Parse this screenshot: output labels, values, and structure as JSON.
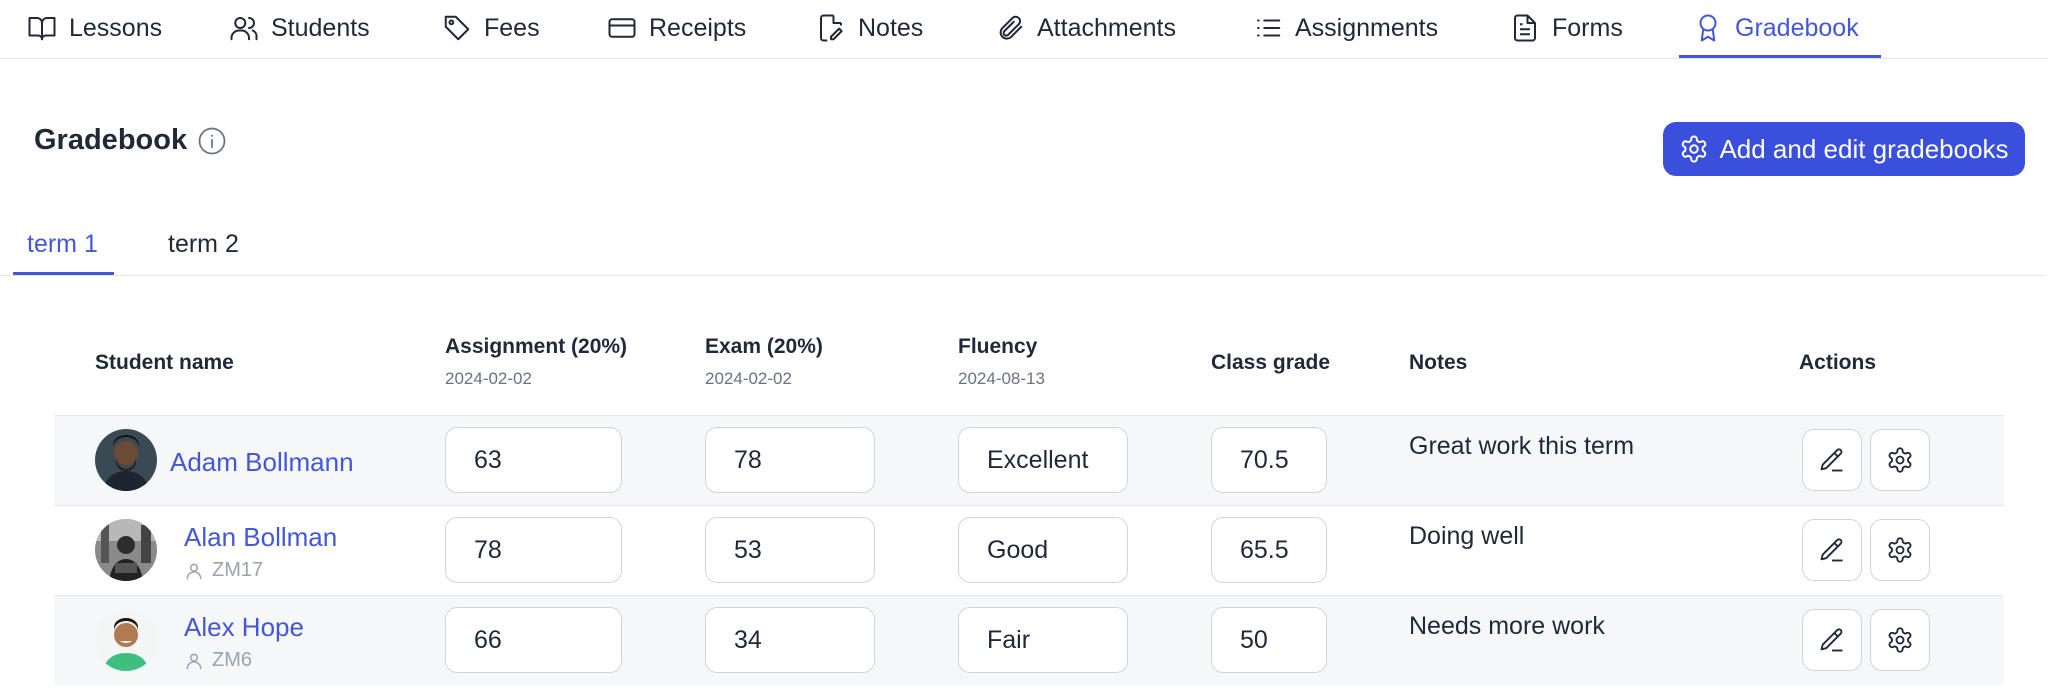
{
  "nav": {
    "items": [
      {
        "label": "Lessons",
        "icon": "book-icon"
      },
      {
        "label": "Students",
        "icon": "users-icon"
      },
      {
        "label": "Fees",
        "icon": "tag-icon"
      },
      {
        "label": "Receipts",
        "icon": "credit-card-icon"
      },
      {
        "label": "Notes",
        "icon": "file-edit-icon"
      },
      {
        "label": "Attachments",
        "icon": "paperclip-icon"
      },
      {
        "label": "Assignments",
        "icon": "list-icon"
      },
      {
        "label": "Forms",
        "icon": "document-icon"
      },
      {
        "label": "Gradebook",
        "icon": "award-icon"
      }
    ],
    "active": "Gradebook"
  },
  "page": {
    "title": "Gradebook",
    "add_button": "Add and edit gradebooks"
  },
  "tabs": {
    "items": [
      "term 1",
      "term 2"
    ],
    "active": "term 1"
  },
  "table": {
    "headers": {
      "student": "Student name",
      "assignment": "Assignment (20%)",
      "assignment_date": "2024-02-02",
      "exam": "Exam (20%)",
      "exam_date": "2024-02-02",
      "fluency": "Fluency",
      "fluency_date": "2024-08-13",
      "class_grade": "Class grade",
      "notes": "Notes",
      "actions": "Actions"
    },
    "rows": [
      {
        "name": "Adam Bollmann",
        "id": "",
        "assignment": "63",
        "exam": "78",
        "fluency": "Excellent",
        "class_grade": "70.5",
        "notes": "Great work this term"
      },
      {
        "name": "Alan Bollman",
        "id": "ZM17",
        "assignment": "78",
        "exam": "53",
        "fluency": "Good",
        "class_grade": "65.5",
        "notes": "Doing well"
      },
      {
        "name": "Alex Hope",
        "id": "ZM6",
        "assignment": "66",
        "exam": "34",
        "fluency": "Fair",
        "class_grade": "50",
        "notes": "Needs more work"
      }
    ]
  },
  "colors": {
    "accent": "#4457d8",
    "button": "#3b4fdd",
    "row_shade": "#f5f7f9",
    "border": "#e5e7eb"
  }
}
